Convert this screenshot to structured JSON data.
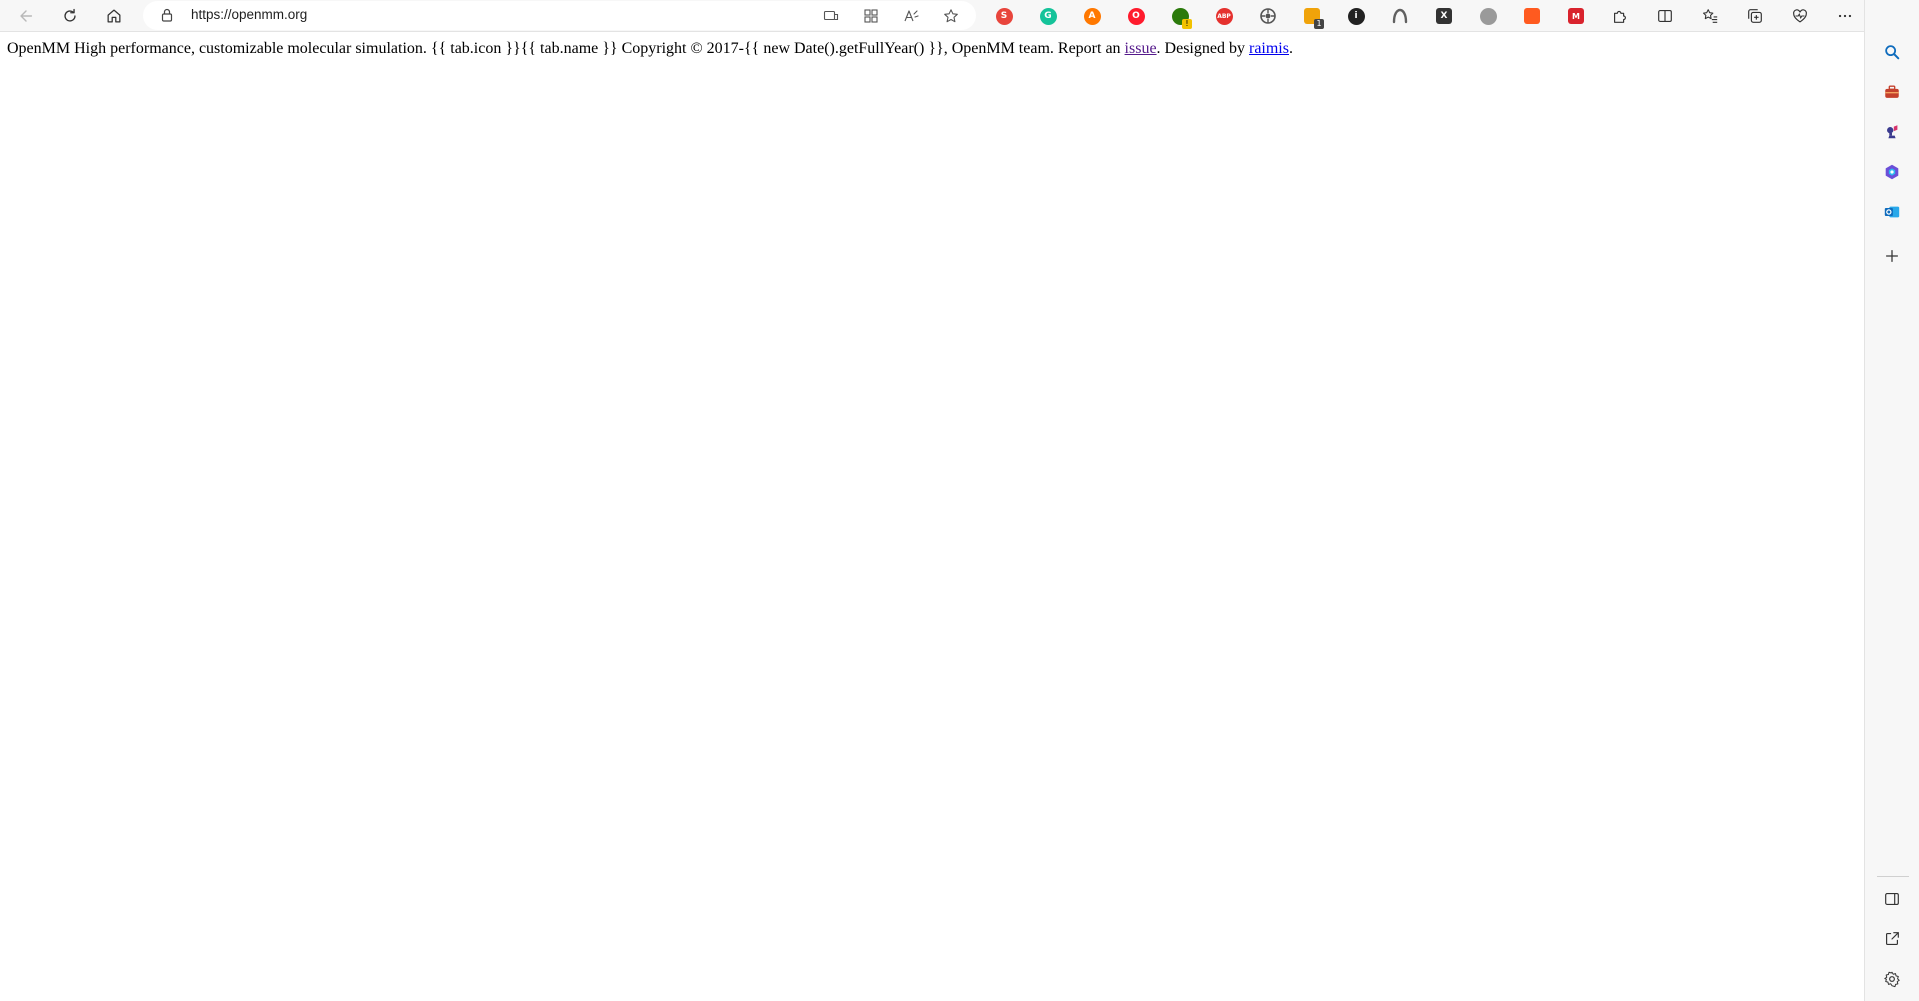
{
  "browser": {
    "url": "https://openmm.org",
    "colors": {
      "toolbar_bg": "#f7f7f7",
      "link": "#0000ee",
      "visited_link": "#551a8b"
    },
    "toolbar_icons": [
      "back-icon",
      "refresh-icon",
      "home-icon"
    ],
    "address_bar_icons": [
      "site-info-lock-icon",
      "app-available-icon",
      "extensions-grid-icon",
      "read-aloud-icon",
      "favorite-star-icon"
    ],
    "extensions": [
      {
        "name": "summarize-extension-icon",
        "color": "#e8453c"
      },
      {
        "name": "grammarly-extension-icon",
        "color": "#15c39a"
      },
      {
        "name": "avast-extension-icon",
        "color": "#ff7800"
      },
      {
        "name": "opera-vpn-extension-icon",
        "color": "#ff1b2d"
      },
      {
        "name": "globe-extension-icon",
        "color": "#2b7a0b",
        "badge": "!"
      },
      {
        "name": "adblock-plus-extension-icon",
        "color": "#e5312e",
        "label": "ABP"
      },
      {
        "name": "settings-wheel-extension-icon",
        "color": "#555555"
      },
      {
        "name": "rewards-extension-icon",
        "color": "#f0a30a",
        "badge": "1"
      },
      {
        "name": "info-extension-icon",
        "color": "#222222"
      },
      {
        "name": "arc-extension-icon",
        "color": "#606060"
      },
      {
        "name": "x-extension-icon",
        "color": "#333333"
      },
      {
        "name": "chat-bubble-extension-icon",
        "color": "#9a9a9a"
      },
      {
        "name": "lock-extension-icon",
        "color": "#ff5a1f"
      },
      {
        "name": "mm-extension-icon",
        "color": "#d9232d"
      }
    ],
    "right_toolbar_icons": [
      "extensions-puzzle-icon",
      "split-screen-icon",
      "favorites-icon",
      "collections-icon",
      "browser-essentials-icon",
      "more-options-icon",
      "bing-copilot-icon"
    ],
    "sidebar_icons": [
      "search-icon",
      "tools-icon",
      "games-icon",
      "microsoft365-icon",
      "outlook-icon",
      "add-icon"
    ],
    "sidebar_bottom_icons": [
      "hide-sidebar-icon",
      "open-external-icon",
      "sidebar-settings-icon"
    ]
  },
  "page": {
    "text_before_issue": "OpenMM High performance, customizable molecular simulation. {{ tab.icon }}{{ tab.name }} Copyright © 2017-{{ new Date().getFullYear() }}, OpenMM team. Report an ",
    "issue_link": "issue",
    "text_between": ". Designed by ",
    "designer_link": "raimis",
    "text_after": "."
  }
}
